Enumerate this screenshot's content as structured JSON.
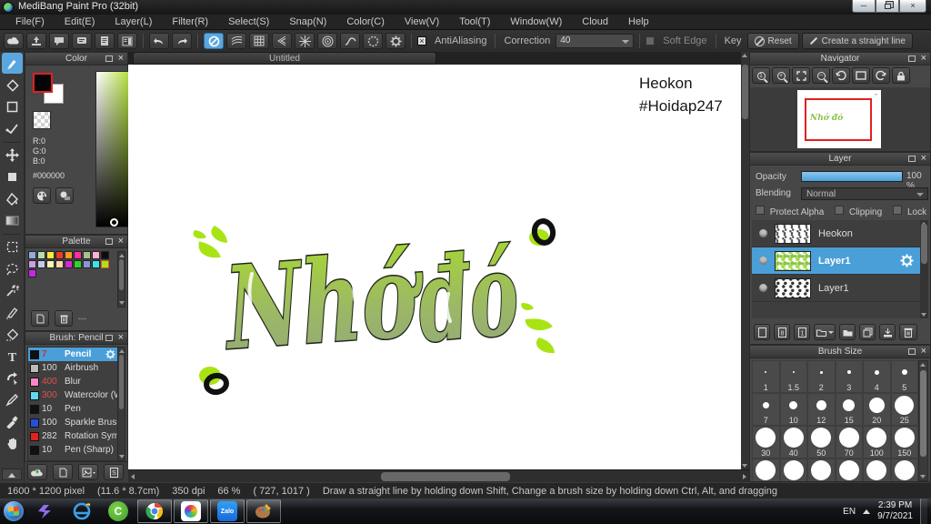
{
  "window": {
    "title": "MediBang Paint Pro (32bit)"
  },
  "menu": {
    "items": [
      "File(F)",
      "Edit(E)",
      "Layer(L)",
      "Filter(R)",
      "Select(S)",
      "Snap(N)",
      "Color(C)",
      "View(V)",
      "Tool(T)",
      "Window(W)",
      "Cloud",
      "Help"
    ]
  },
  "toolbar": {
    "antialiasing": "AntiAliasing",
    "correction_label": "Correction",
    "correction_value": "40",
    "soft_edge": "Soft Edge",
    "key_label": "Key",
    "reset": "Reset",
    "straight_line": "Create a straight line"
  },
  "color_panel": {
    "title": "Color",
    "r": "R:0",
    "g": "G:0",
    "b": "B:0",
    "hex": "#000000"
  },
  "palette": {
    "title": "Palette",
    "empty_value": "---",
    "colors": [
      "#96aadc",
      "#b9dcae",
      "#ffe93c",
      "#ee3b27",
      "#ff9b1f",
      "#ff2d9e",
      "#a9c08b",
      "#ffb0d8",
      "#0c0c0c",
      "#c9a0e2",
      "#c5cae9",
      "#fcf4b5",
      "#fbd9a9",
      "#d42ad4",
      "#2fd32f",
      "#8795da",
      "#36e6e6",
      "#a9e517",
      "#c428df"
    ],
    "selected_index": 17
  },
  "brush_panel": {
    "title": "Brush: Pencil",
    "brushes": [
      {
        "size": "7",
        "name": "Pencil",
        "swatch": "#111111",
        "size_red": true,
        "selected": true
      },
      {
        "size": "100",
        "name": "Airbrush",
        "swatch": "#bbbbbb",
        "size_red": false,
        "selected": false
      },
      {
        "size": "400",
        "name": "Blur",
        "swatch": "#ff86c8",
        "size_red": true,
        "selected": false
      },
      {
        "size": "300",
        "name": "Watercolor (W",
        "swatch": "#62d8ee",
        "size_red": true,
        "selected": false
      },
      {
        "size": "10",
        "name": "Pen",
        "swatch": "#111111",
        "size_red": false,
        "selected": false
      },
      {
        "size": "100",
        "name": "Sparkle Brush",
        "swatch": "#2351d8",
        "size_red": false,
        "selected": false
      },
      {
        "size": "282",
        "name": "Rotation Sym",
        "swatch": "#e02222",
        "size_red": false,
        "selected": false
      },
      {
        "size": "10",
        "name": "Pen (Sharp)",
        "swatch": "#111111",
        "size_red": false,
        "selected": false
      }
    ]
  },
  "canvas": {
    "tab": "Untitled",
    "signature_line1": "Heokon",
    "signature_line2": "#Hoidap247",
    "artwork_word1": "Nhớ",
    "artwork_word2": "đó"
  },
  "navigator": {
    "title": "Navigator",
    "thumb_text": "Nhớ đó"
  },
  "layer_panel": {
    "title": "Layer",
    "opacity_label": "Opacity",
    "opacity_value": "100 %",
    "blending_label": "Blending",
    "blending_value": "Normal",
    "protect_alpha": "Protect Alpha",
    "clipping": "Clipping",
    "lock": "Lock",
    "layers": [
      {
        "name": "Heokon",
        "selected": false,
        "marks": "marks-text"
      },
      {
        "name": "Layer1",
        "selected": true,
        "marks": "marks-green"
      },
      {
        "name": "Layer1",
        "selected": false,
        "marks": "marks-black"
      }
    ]
  },
  "brush_size_panel": {
    "title": "Brush Size",
    "sizes": [
      "1",
      "1.5",
      "2",
      "3",
      "4",
      "5",
      "7",
      "10",
      "12",
      "15",
      "20",
      "25",
      "30",
      "40",
      "50",
      "70",
      "100",
      "150"
    ]
  },
  "status_bar": {
    "dimensions": "1600 * 1200 pixel",
    "size_cm": "(11.6 * 8.7cm)",
    "dpi": "350 dpi",
    "zoom": "66 %",
    "coords": "( 727, 1017 )",
    "hint": "Draw a straight line by holding down Shift, Change a brush size by holding down Ctrl, Alt, and dragging"
  },
  "taskbar": {
    "language": "EN",
    "time": "2:39 PM",
    "date": "9/7/2021",
    "zalo_label": "Zalo"
  },
  "colors": {
    "accent_blue": "#4a9fd8",
    "view_rect_red": "#e02020",
    "artwork_green_top": "#a8d832",
    "artwork_green_bottom": "#92a57e",
    "decor_green": "#a8e414"
  }
}
